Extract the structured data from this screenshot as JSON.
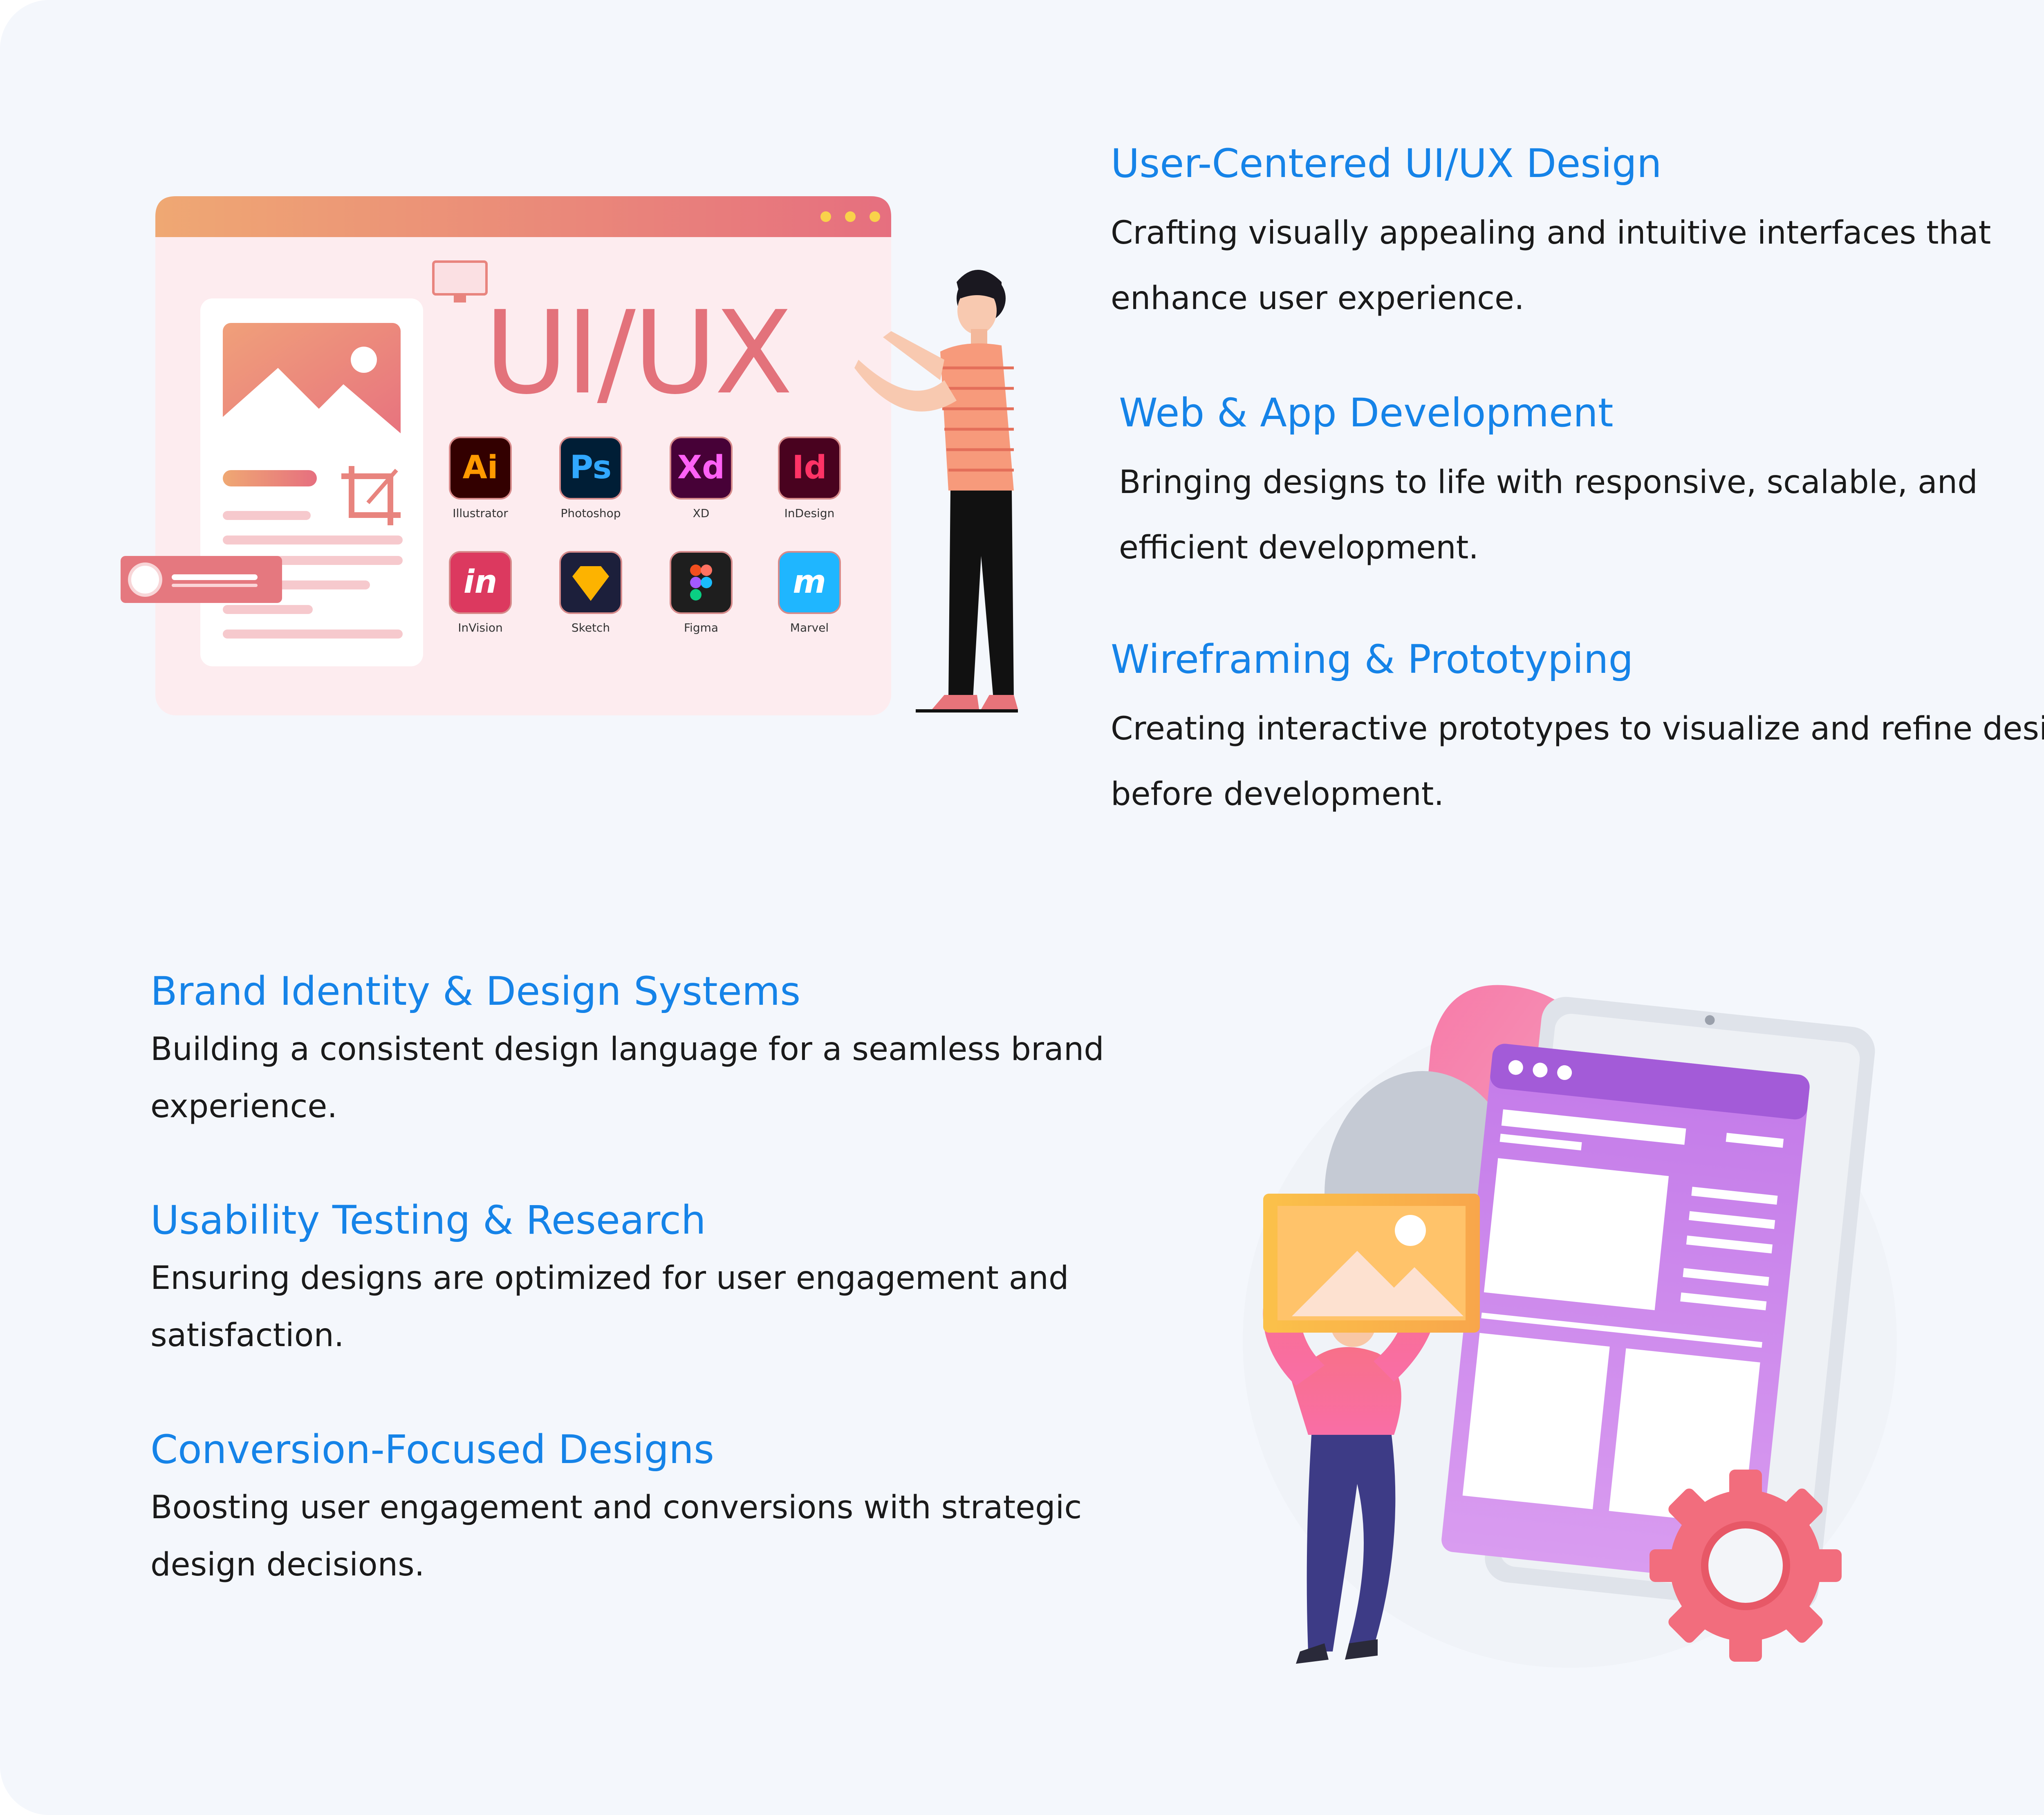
{
  "services_top": [
    {
      "title": "User-Centered UI/UX Design",
      "desc_line1": "Crafting visually appealing and intuitive interfaces that",
      "desc_line2": "enhance user experience."
    },
    {
      "title": "Web & App Development",
      "desc_line1": "Bringing designs to life with responsive, scalable, and",
      "desc_line2": "efficient development."
    },
    {
      "title": "Wireframing & Prototyping",
      "desc_line1": "Creating interactive prototypes to visualize and refine designs",
      "desc_line2": "before development."
    }
  ],
  "services_bottom": [
    {
      "title": "Brand Identity & Design Systems",
      "desc_line1": "Building a consistent design language for a seamless brand",
      "desc_line2": "experience."
    },
    {
      "title": "Usability Testing & Research",
      "desc_line1": "Ensuring designs are optimized for user engagement and",
      "desc_line2": "satisfaction."
    },
    {
      "title": "Conversion-Focused Designs",
      "desc_line1": "Boosting user engagement and conversions with strategic",
      "desc_line2": "design decisions."
    }
  ],
  "illustration_top": {
    "heading": "UI/UX",
    "apps": [
      {
        "abbr": "Ai",
        "label": "Illustrator",
        "bg": "#330000",
        "fg": "#ff9a00"
      },
      {
        "abbr": "Ps",
        "label": "Photoshop",
        "bg": "#001e36",
        "fg": "#31a8ff"
      },
      {
        "abbr": "Xd",
        "label": "XD",
        "bg": "#470137",
        "fg": "#ff61f6"
      },
      {
        "abbr": "Id",
        "label": "InDesign",
        "bg": "#49021f",
        "fg": "#ff3366"
      },
      {
        "abbr": "in",
        "label": "InVision",
        "bg": "#dc395f",
        "fg": "#ffffff"
      },
      {
        "abbr": "",
        "label": "Sketch",
        "bg": "#1c1f3b",
        "fg": "#fdb300"
      },
      {
        "abbr": "",
        "label": "Figma",
        "bg": "#1e1e1e",
        "fg": "#ffffff"
      },
      {
        "abbr": "m",
        "label": "Marvel",
        "bg": "#1fb6ff",
        "fg": "#ffffff"
      }
    ]
  },
  "colors": {
    "title_blue": "#1583e8",
    "body_text": "#1a1a1a",
    "card_bg": "#f4f7fc",
    "accent_coral": "#e9787f",
    "accent_purple": "#b77ae6"
  }
}
